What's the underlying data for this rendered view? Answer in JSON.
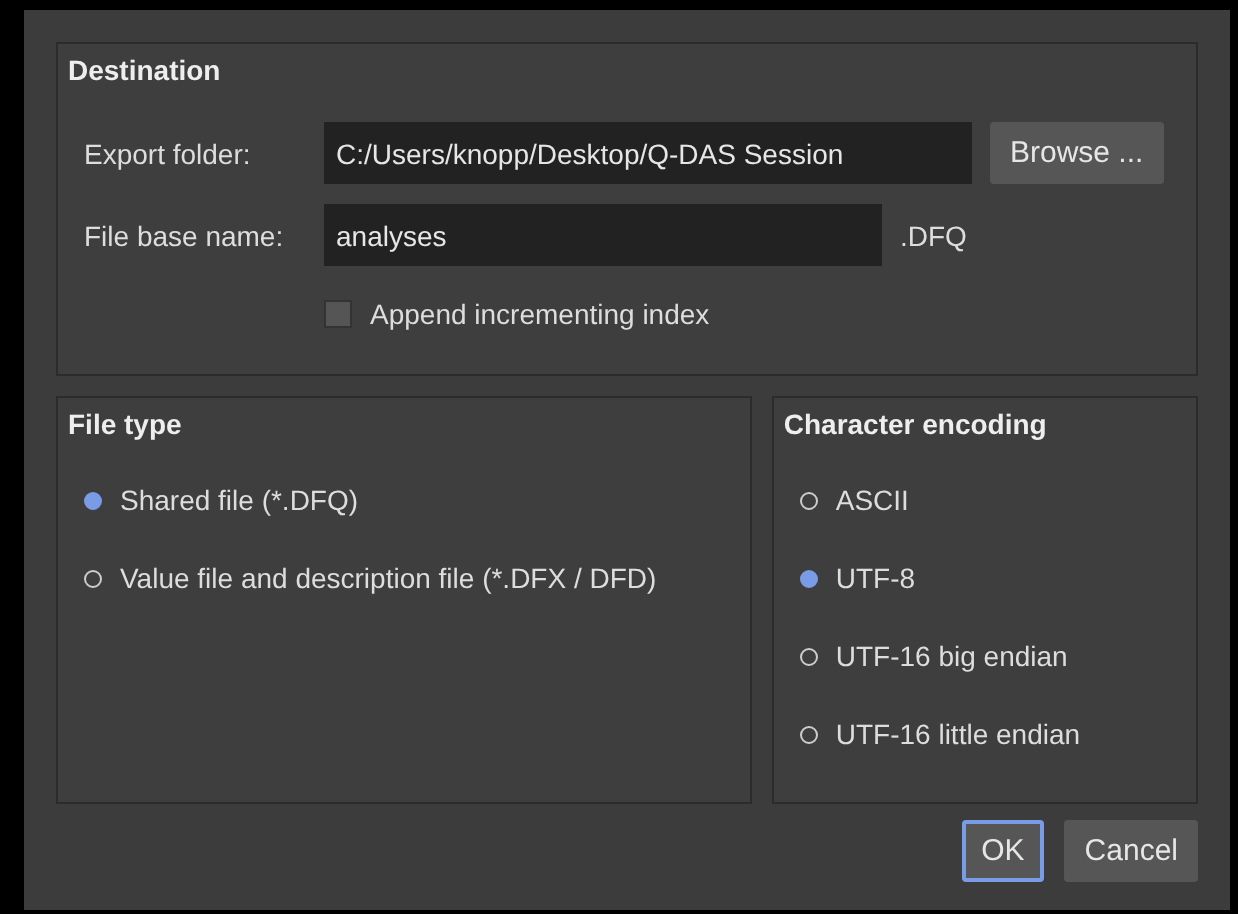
{
  "destination": {
    "title": "Destination",
    "export_folder": {
      "label": "Export folder:",
      "value": "C:/Users/knopp/Desktop/Q-DAS Session",
      "button": "Browse ..."
    },
    "file_base_name": {
      "label": "File base name:",
      "value": "analyses",
      "suffix": ".DFQ"
    },
    "append_index": {
      "label": "Append incrementing index",
      "checked": false
    }
  },
  "file_type": {
    "title": "File type",
    "options": [
      {
        "label": "Shared file (*.DFQ)",
        "selected": true
      },
      {
        "label": "Value file and description file (*.DFX / DFD)",
        "selected": false
      }
    ]
  },
  "character_encoding": {
    "title": "Character encoding",
    "options": [
      {
        "label": "ASCII",
        "selected": false
      },
      {
        "label": "UTF-8",
        "selected": true
      },
      {
        "label": "UTF-16 big endian",
        "selected": false
      },
      {
        "label": "UTF-16 little endian",
        "selected": false
      }
    ]
  },
  "buttons": [
    {
      "label": "OK",
      "focused": true
    },
    {
      "label": "Cancel",
      "focused": false
    }
  ]
}
